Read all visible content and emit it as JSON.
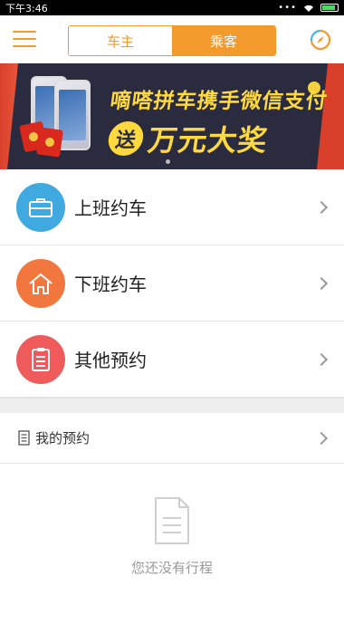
{
  "status_bar": {
    "time": "下午3:46",
    "dots": "•••"
  },
  "header": {
    "tabs": [
      {
        "label": "车主",
        "active": false
      },
      {
        "label": "乘客",
        "active": true
      }
    ],
    "accent_color": "#f39a2d"
  },
  "banner": {
    "line1": "嘀嗒拼车携手微信支付",
    "badge": "送",
    "prize": "万元大奖",
    "page_index": 1,
    "page_count": 1
  },
  "menu": [
    {
      "label": "上班约车",
      "icon": "briefcase-icon",
      "color": "#3fa9e0"
    },
    {
      "label": "下班约车",
      "icon": "home-icon",
      "color": "#f2773e"
    },
    {
      "label": "其他预约",
      "icon": "document-icon",
      "color": "#ef5a5a"
    }
  ],
  "my_reservations": {
    "label": "我的预约",
    "icon": "list-icon"
  },
  "empty_state": {
    "text": "您还没有行程",
    "icon": "empty-document-icon"
  }
}
